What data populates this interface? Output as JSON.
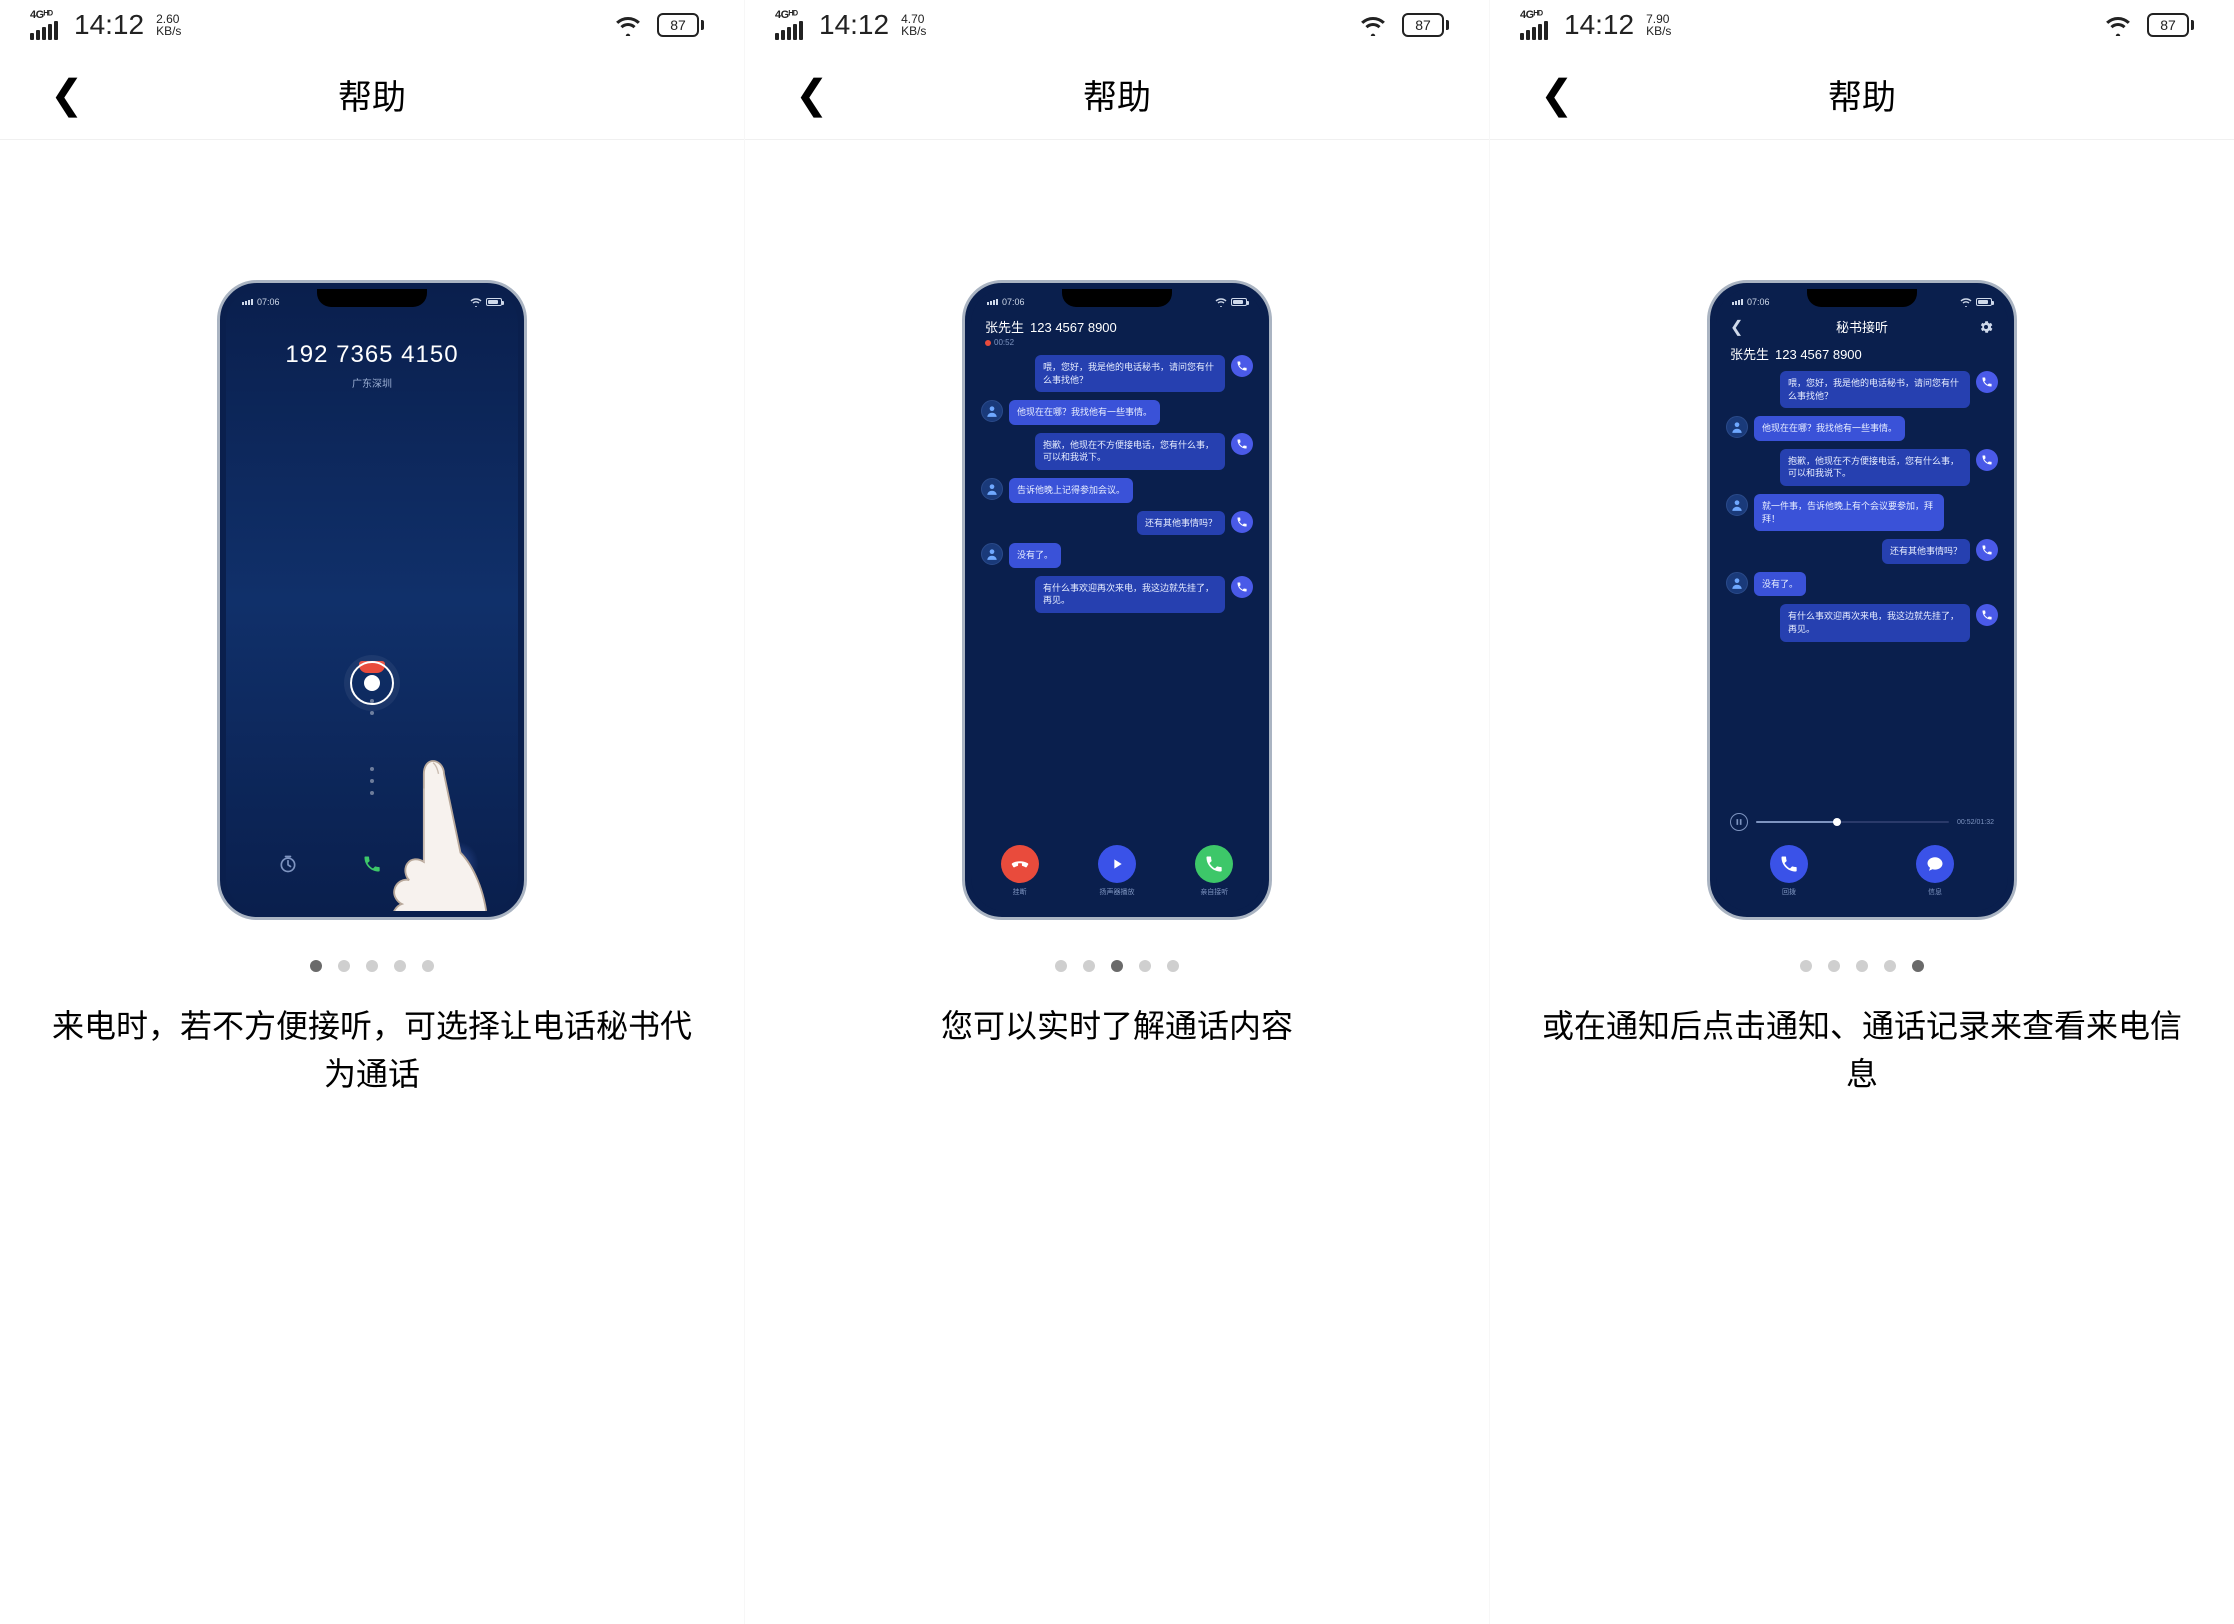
{
  "panels": [
    {
      "statusbar": {
        "net": "4Gᴴᴰ",
        "time": "14:12",
        "speed": "2.60",
        "speed_unit": "KB/s",
        "battery": "87"
      },
      "header": {
        "title": "帮助"
      },
      "call": {
        "number": "192 7365 4150",
        "location": "广东深圳",
        "phone_time": "07:06"
      },
      "dots_active": 0,
      "caption": "来电时，若不方便接听，可选择让电话秘书代为通话"
    },
    {
      "statusbar": {
        "net": "4Gᴴᴰ",
        "time": "14:12",
        "speed": "4.70",
        "speed_unit": "KB/s",
        "battery": "87"
      },
      "header": {
        "title": "帮助"
      },
      "chat": {
        "phone_time": "07:06",
        "caller_name": "张先生",
        "caller_number": "123 4567 8900",
        "duration": "00:52",
        "messages": [
          {
            "side": "right",
            "avatar": "s",
            "text": "喂，您好，我是他的电话秘书，请问您有什么事找他？"
          },
          {
            "side": "left",
            "avatar": "u",
            "text": "他现在在哪？我找他有一些事情。"
          },
          {
            "side": "right",
            "avatar": "s",
            "text": "抱歉，他现在不方便接电话，您有什么事，可以和我说下。"
          },
          {
            "side": "left",
            "avatar": "u",
            "text": "告诉他晚上记得参加会议。"
          },
          {
            "side": "right",
            "avatar": "s",
            "text": "还有其他事情吗？"
          },
          {
            "side": "left",
            "avatar": "u",
            "text": "没有了。"
          },
          {
            "side": "right",
            "avatar": "s",
            "text": "有什么事欢迎再次来电，我这边就先挂了，再见。"
          }
        ],
        "actions": [
          {
            "icon": "red",
            "label": "挂断"
          },
          {
            "icon": "blue",
            "label": "扬声器播放"
          },
          {
            "icon": "green",
            "label": "亲自接听"
          }
        ]
      },
      "dots_active": 2,
      "caption": "您可以实时了解通话内容"
    },
    {
      "statusbar": {
        "net": "4Gᴴᴰ",
        "time": "14:12",
        "speed": "7.90",
        "speed_unit": "KB/s",
        "battery": "87"
      },
      "header": {
        "title": "帮助"
      },
      "playback": {
        "phone_time": "07:06",
        "page_title": "秘书接听",
        "caller_name": "张先生",
        "caller_number": "123 4567 8900",
        "messages": [
          {
            "side": "right",
            "avatar": "s",
            "text": "喂，您好，我是他的电话秘书，请问您有什么事找他？"
          },
          {
            "side": "left",
            "avatar": "u",
            "text": "他现在在哪？我找他有一些事情。"
          },
          {
            "side": "right",
            "avatar": "s",
            "text": "抱歉，他现在不方便接电话，您有什么事，可以和我说下。"
          },
          {
            "side": "left",
            "avatar": "u",
            "text": "就一件事，告诉他晚上有个会议要参加，拜拜！"
          },
          {
            "side": "right",
            "avatar": "s",
            "text": "还有其他事情吗？"
          },
          {
            "side": "left",
            "avatar": "u",
            "text": "没有了。"
          },
          {
            "side": "right",
            "avatar": "s",
            "text": "有什么事欢迎再次来电，我这边就先挂了，再见。"
          }
        ],
        "time_elapsed": "00:52",
        "time_total": "01:32",
        "actions": [
          {
            "icon": "blue",
            "svg": "phone",
            "label": "回拨"
          },
          {
            "icon": "blue",
            "svg": "msg",
            "label": "信息"
          }
        ]
      },
      "dots_active": 4,
      "caption": "或在通知后点击通知、通话记录来查看来电信息"
    }
  ]
}
